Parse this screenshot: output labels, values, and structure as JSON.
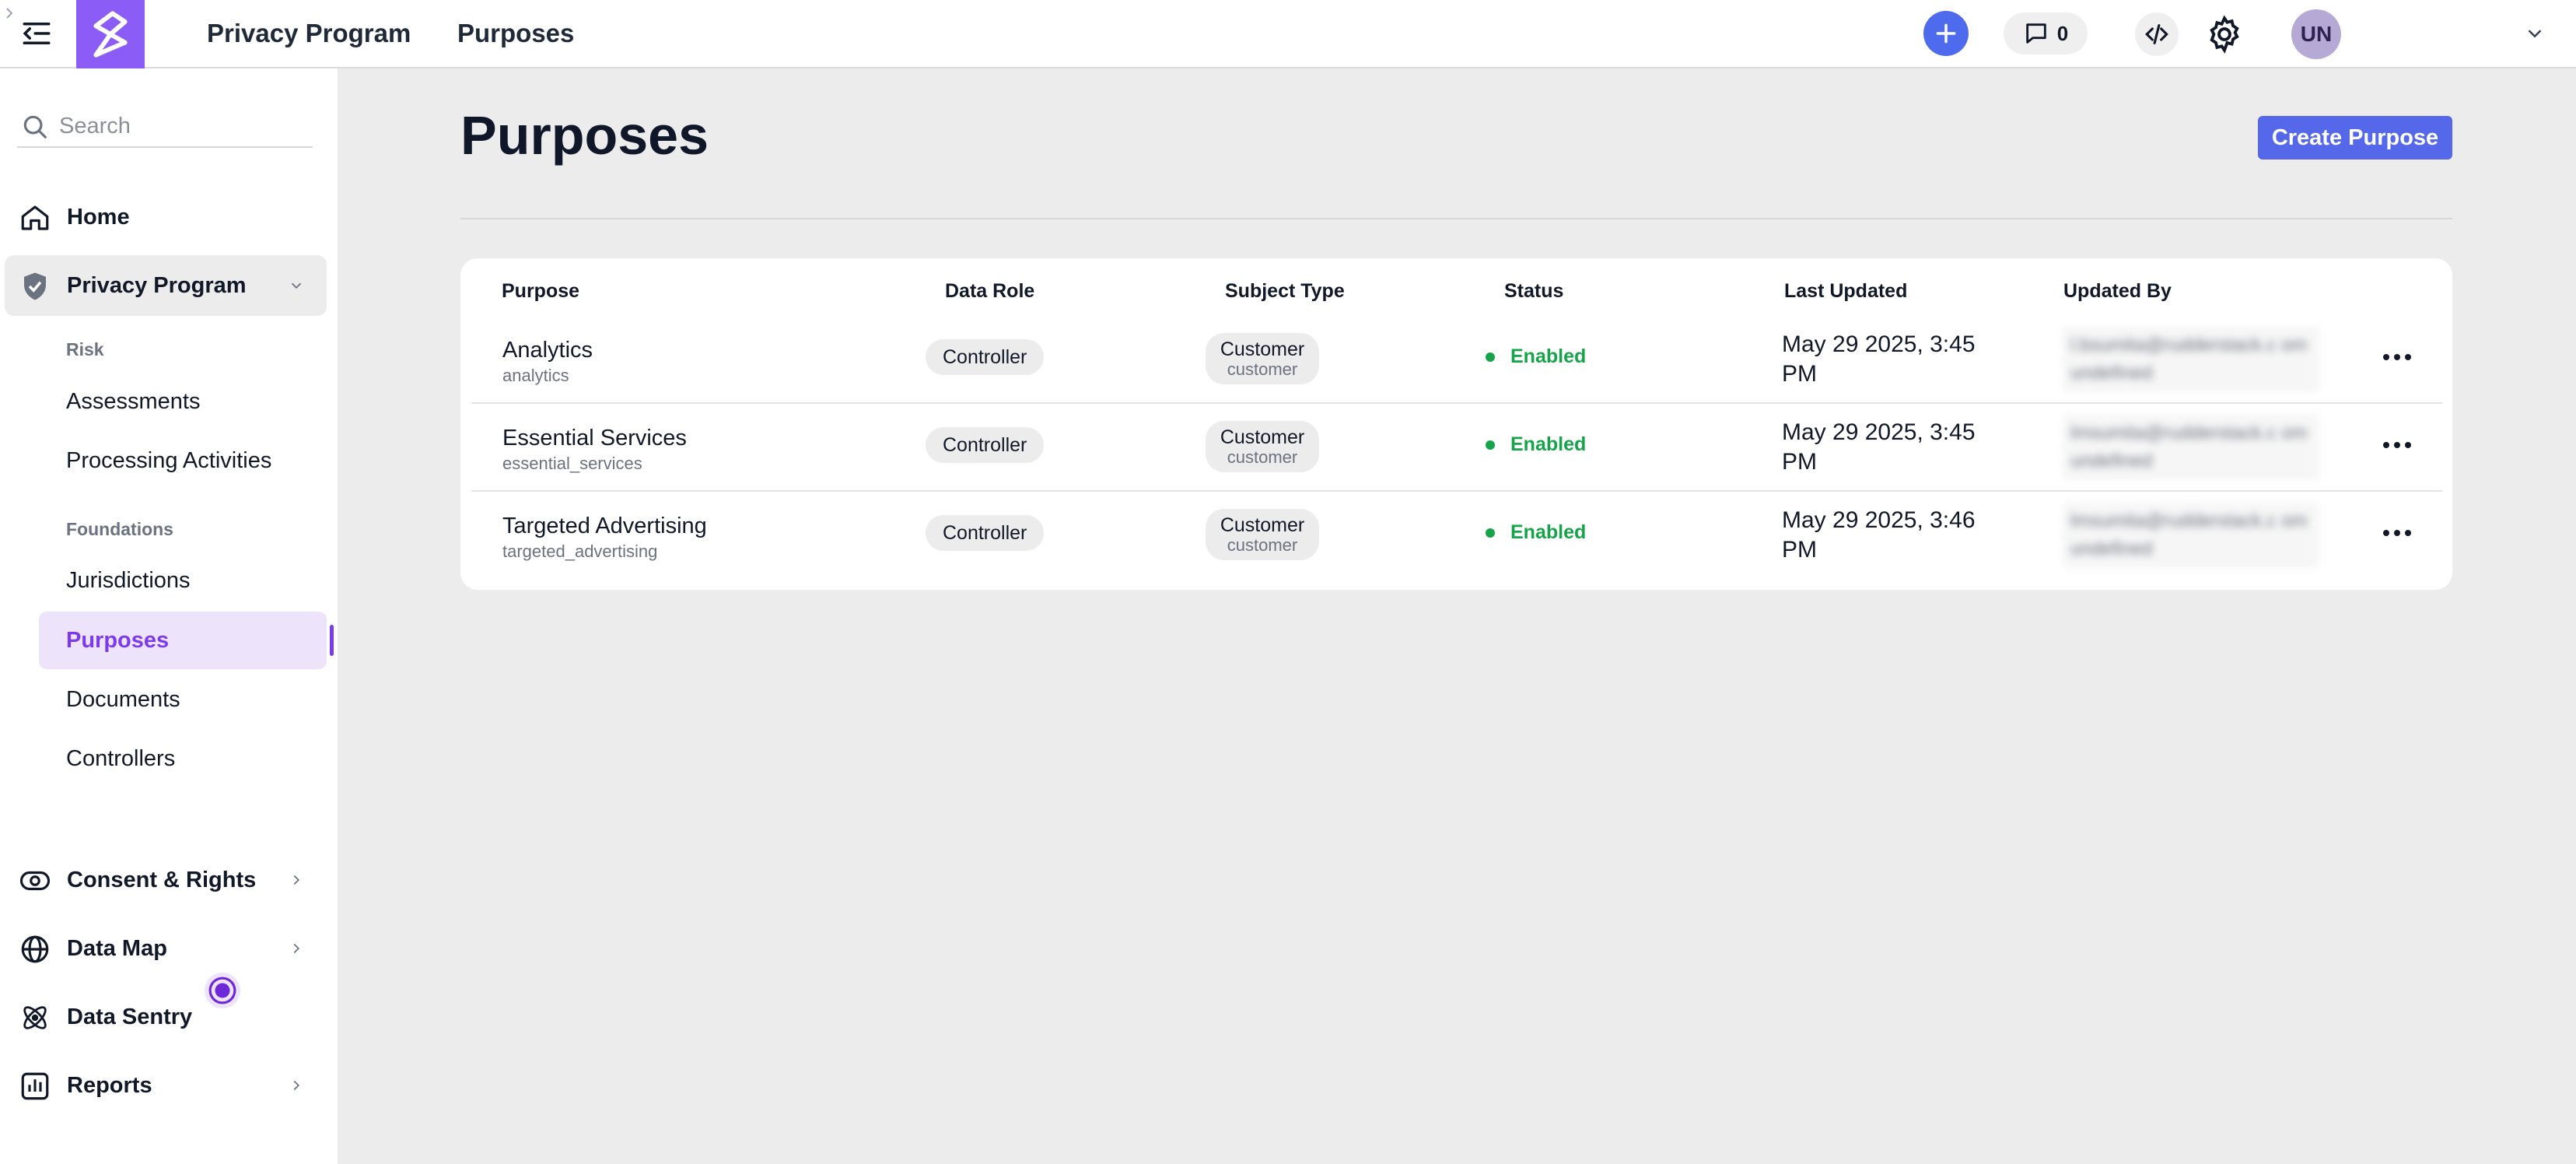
{
  "topbar": {
    "breadcrumb": {
      "parent": "Privacy Program",
      "current": "Purposes"
    },
    "comment_count": "0",
    "avatar_initials": "UN"
  },
  "sidebar": {
    "search_placeholder": "Search",
    "home": "Home",
    "privacy_program": "Privacy Program",
    "section_risk": "Risk",
    "assessments": "Assessments",
    "processing_activities": "Processing Activities",
    "section_foundations": "Foundations",
    "jurisdictions": "Jurisdictions",
    "purposes": "Purposes",
    "documents": "Documents",
    "controllers": "Controllers",
    "consent_rights": "Consent & Rights",
    "data_map": "Data Map",
    "data_sentry": "Data Sentry",
    "reports": "Reports"
  },
  "main": {
    "title": "Purposes",
    "create_button": "Create Purpose",
    "columns": [
      "Purpose",
      "Data Role",
      "Subject Type",
      "Status",
      "Last Updated",
      "Updated By"
    ],
    "rows": [
      {
        "name": "Analytics",
        "key": "analytics",
        "role": "Controller",
        "subject": "Customer",
        "subject_key": "customer",
        "status": "Enabled",
        "updated": "May 29 2025, 3:45 PM",
        "updated_by": "l.bsumita@rudderstack.c om undefined"
      },
      {
        "name": "Essential Services",
        "key": "essential_services",
        "role": "Controller",
        "subject": "Customer",
        "subject_key": "customer",
        "status": "Enabled",
        "updated": "May 29 2025, 3:45 PM",
        "updated_by": "lmsumita@rudderstack.c om undefined"
      },
      {
        "name": "Targeted Advertising",
        "key": "targeted_advertising",
        "role": "Controller",
        "subject": "Customer",
        "subject_key": "customer",
        "status": "Enabled",
        "updated": "May 29 2025, 3:46 PM",
        "updated_by": "lmsumita@rudderstack.c om undefined"
      }
    ]
  },
  "colors": {
    "accent": "#7c3aed",
    "primary_button": "#5668ea",
    "status_enabled": "#16a34a"
  }
}
